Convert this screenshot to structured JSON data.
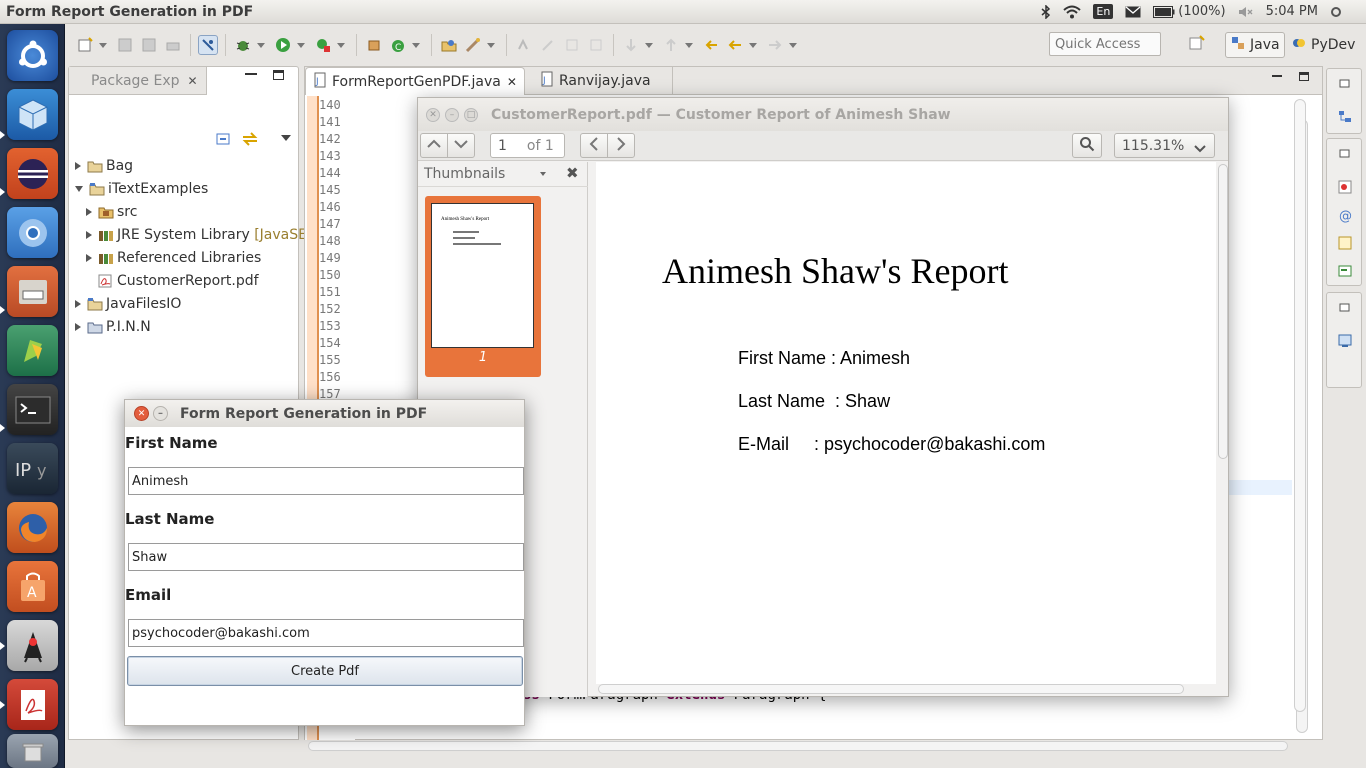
{
  "topbar": {
    "title": "Form Report Generation in PDF",
    "lang": "En",
    "battery": "(100%)",
    "clock": "5:04 PM"
  },
  "launcher": {
    "icons": [
      "ubuntu-dash-icon",
      "virtualbox-icon",
      "eclipse-icon",
      "chromium-icon",
      "file-manager-icon",
      "pycharm-icon",
      "terminal-icon",
      "ipython-icon",
      "firefox-icon",
      "software-center-icon",
      "java-icon",
      "pdf-viewer-icon",
      "trash-icon"
    ]
  },
  "toolbar": {
    "quick_access_placeholder": "Quick Access",
    "perspectives": [
      "Java",
      "PyDev"
    ]
  },
  "package_explorer": {
    "tab_label": "Package Exp",
    "tree": [
      {
        "label": "Bag",
        "level": 0,
        "state": "closed"
      },
      {
        "label": "iTextExamples",
        "level": 0,
        "state": "open"
      },
      {
        "label": "src",
        "level": 1,
        "state": "closed"
      },
      {
        "label": "JRE System Library",
        "suffix": "[JavaSE-",
        "level": 1,
        "state": "closed"
      },
      {
        "label": "Referenced Libraries",
        "level": 1,
        "state": "closed"
      },
      {
        "label": "CustomerReport.pdf",
        "level": 1,
        "state": "none"
      },
      {
        "label": "JavaFilesIO",
        "level": 0,
        "state": "closed"
      },
      {
        "label": "P.I.N.N",
        "level": 0,
        "state": "closed"
      }
    ]
  },
  "editor": {
    "tabs": [
      "FormReportGenPDF.java",
      "Ranvijay.java"
    ],
    "line_numbers": [
      "140",
      "141",
      "142",
      "143",
      "144",
      "145",
      "146",
      "147",
      "148",
      "149",
      "150",
      "151",
      "152",
      "153",
      "154",
      "155",
      "156",
      "157"
    ],
    "code_tail_kw1": "ss",
    "code_tail_name": " FormParagraph ",
    "code_tail_kw2": "extends",
    "code_tail_rest": " Paragraph {"
  },
  "pdf_viewer": {
    "window_title": "CustomerReport.pdf — Customer Report of Animesh Shaw",
    "page_current": "1",
    "page_total": "of 1",
    "zoom": "115.31%",
    "thumbnails_label": "Thumbnails",
    "thumb_page_number": "1",
    "page": {
      "title": "Animesh Shaw's Report",
      "lines": [
        "First Name : Animesh",
        "Last Name  : Shaw",
        "E-Mail     : psychocoder@bakashi.com"
      ]
    }
  },
  "form": {
    "title": "Form Report Generation in PDF",
    "first_name_label": "First Name",
    "first_name_value": "Animesh",
    "last_name_label": "Last Name",
    "last_name_value": "Shaw",
    "email_label": "Email",
    "email_value": "psychocoder@bakashi.com",
    "create_button": "Create Pdf"
  },
  "colors": {
    "launcher_bg": "#24324d",
    "thumb_highlight": "#e8743b",
    "keyword": "#7f0055"
  }
}
